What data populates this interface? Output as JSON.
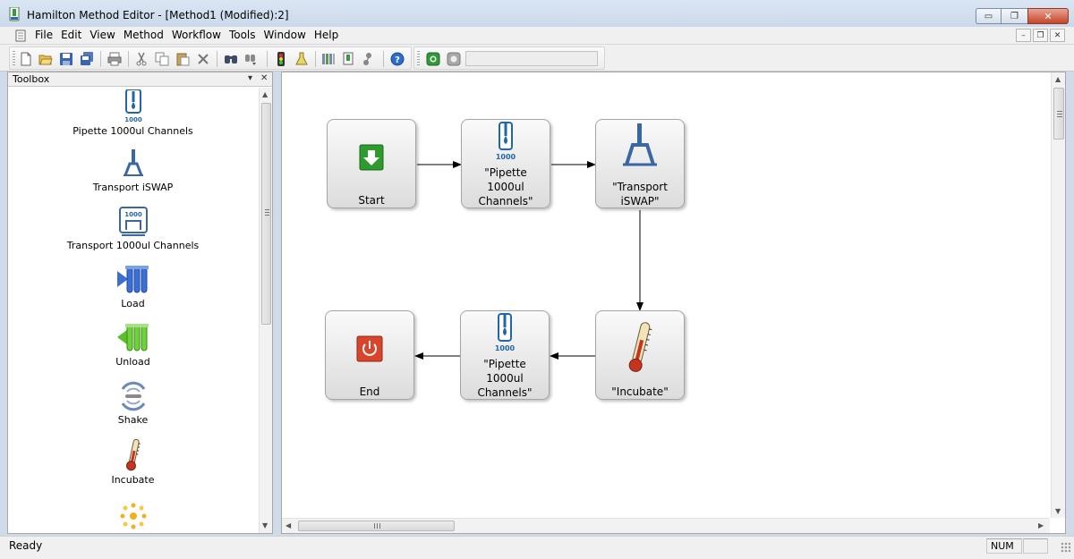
{
  "window": {
    "title": "Hamilton Method Editor - [Method1 (Modified):2]",
    "minimize_glyph": "▭",
    "maximize_glyph": "❐",
    "close_glyph": "✕"
  },
  "menu": {
    "items": [
      "File",
      "Edit",
      "View",
      "Method",
      "Workflow",
      "Tools",
      "Window",
      "Help"
    ],
    "mdi": {
      "minimize": "–",
      "restore": "❐",
      "close": "✕"
    }
  },
  "toolbar": {
    "icons": [
      "new-document-icon",
      "open-folder-icon",
      "save-icon",
      "save-all-icon",
      "print-icon",
      "cut-icon",
      "copy-icon",
      "paste-icon",
      "delete-icon",
      "find-icon",
      "replace-icon",
      "run-method-icon",
      "flask-icon",
      "deck-layout-icon",
      "tip-icon",
      "liquid-class-icon",
      "help-icon",
      "green-status-icon",
      "gray-status-icon"
    ]
  },
  "toolbox": {
    "title": "Toolbox",
    "pin_glyph": "▾",
    "close_glyph": "✕",
    "items": [
      {
        "label": "Pipette 1000ul Channels",
        "icon": "pipette-channels-icon"
      },
      {
        "label": "Transport iSWAP",
        "icon": "iswap-gripper-icon"
      },
      {
        "label": "Transport 1000ul Channels",
        "icon": "transport-channels-icon"
      },
      {
        "label": "Load",
        "icon": "load-icon"
      },
      {
        "label": "Unload",
        "icon": "unload-icon"
      },
      {
        "label": "Shake",
        "icon": "shake-icon"
      },
      {
        "label": "Incubate",
        "icon": "thermometer-icon"
      },
      {
        "label": "",
        "icon": "sparkle-icon"
      }
    ],
    "pipette_volume_label": "1000",
    "scroll": {
      "up": "▲",
      "down": "▼"
    }
  },
  "workflow": {
    "nodes": [
      {
        "id": "start",
        "label": "Start",
        "icon": "start-arrow-icon"
      },
      {
        "id": "pipette1",
        "label": "\"Pipette\n1000ul\nChannels\"",
        "icon": "pipette-channels-icon"
      },
      {
        "id": "transport",
        "label": "\"Transport\niSWAP\"",
        "icon": "iswap-gripper-icon"
      },
      {
        "id": "incubate",
        "label": "\"Incubate\"",
        "icon": "thermometer-icon"
      },
      {
        "id": "pipette2",
        "label": "\"Pipette\n1000ul\nChannels\"",
        "icon": "pipette-channels-icon"
      },
      {
        "id": "end",
        "label": "End",
        "icon": "power-icon"
      }
    ],
    "edges": [
      [
        "start",
        "pipette1"
      ],
      [
        "pipette1",
        "transport"
      ],
      [
        "transport",
        "incubate"
      ],
      [
        "incubate",
        "pipette2"
      ],
      [
        "pipette2",
        "end"
      ]
    ],
    "pipette_volume_label": "1000",
    "scroll": {
      "left": "◀",
      "right": "▶",
      "up": "▲",
      "down": "▼"
    }
  },
  "colors": {
    "start_green": "#2e9b2e",
    "end_red": "#d9452b",
    "pipette_blue": "#2166a8",
    "gripper_blue": "#3a66a6",
    "load_blue": "#3b6fd1",
    "unload_green": "#5abf2b",
    "thermo_red": "#c8321f"
  },
  "status": {
    "text": "Ready",
    "num": "NUM"
  }
}
